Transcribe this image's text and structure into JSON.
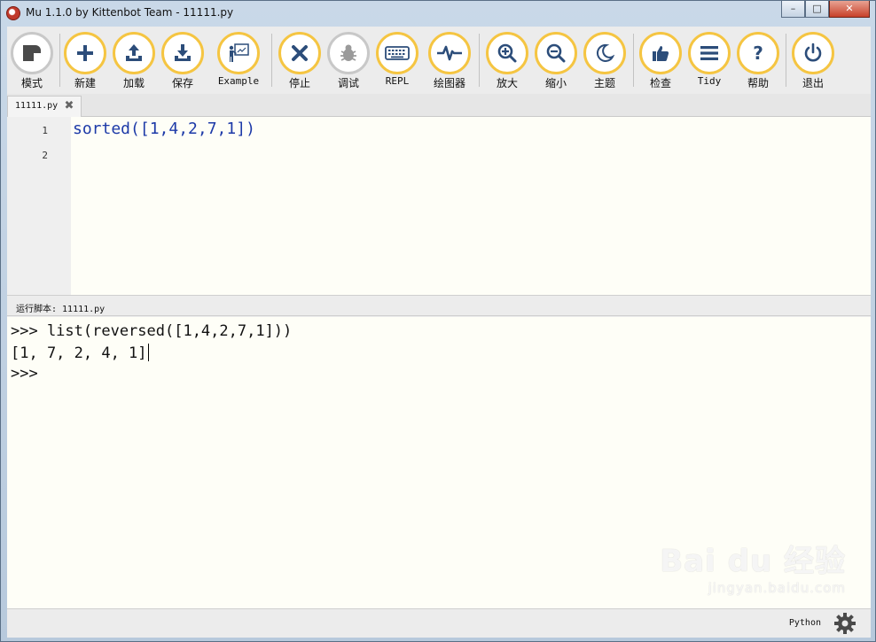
{
  "window": {
    "title": "Mu 1.1.0 by Kittenbot Team - 11111.py"
  },
  "toolbar": {
    "mode": "模式",
    "new": "新建",
    "load": "加载",
    "save": "保存",
    "example": "Example",
    "stop": "停止",
    "debug": "调试",
    "repl": "REPL",
    "plotter": "绘图器",
    "zoom_in": "放大",
    "zoom_out": "缩小",
    "theme": "主题",
    "check": "检查",
    "tidy": "Tidy",
    "help": "帮助",
    "quit": "退出"
  },
  "tabs": [
    {
      "label": "11111.py"
    }
  ],
  "editor": {
    "line_numbers": [
      "1",
      "2"
    ],
    "lines": [
      "sorted([1,4,2,7,1])",
      ""
    ]
  },
  "run": {
    "label": "运行脚本: 11111.py"
  },
  "repl": {
    "lines": [
      ">>> list(reversed([1,4,2,7,1]))",
      "[1, 7, 2, 4, 1]",
      ">>>"
    ]
  },
  "status": {
    "mode": "Python"
  },
  "watermark": {
    "main": "Bai du 经验",
    "sub": "jingyan.baidu.com"
  },
  "colors": {
    "accent": "#f5c542",
    "icon_blue": "#2c4d7a",
    "editor_bg": "#fefef7",
    "code_text": "#1d3aa8"
  }
}
